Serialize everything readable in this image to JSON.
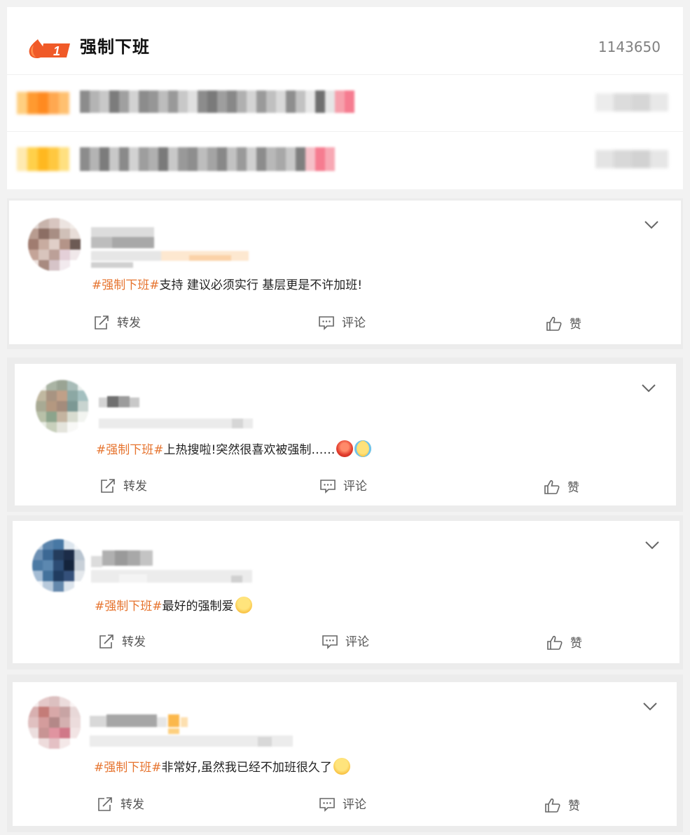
{
  "topic": {
    "rank": "1",
    "title": "强制下班",
    "count": "1143650"
  },
  "posts": [
    {
      "topic_tag": "#强制下班#",
      "text": "支持 建议必须实行 基层更是不许加班!",
      "actions": {
        "repost": "转发",
        "comment": "评论",
        "like": "赞"
      }
    },
    {
      "topic_tag": "#强制下班#",
      "text": "上热搜啦!突然很喜欢被强制……",
      "emojis": [
        "pouting-face-emoji",
        "tears-of-joy-emoji"
      ],
      "actions": {
        "repost": "转发",
        "comment": "评论",
        "like": "赞"
      }
    },
    {
      "topic_tag": "#强制下班#",
      "text": "最好的强制爱",
      "emojis": [
        "smirk-face-emoji"
      ],
      "actions": {
        "repost": "转发",
        "comment": "评论",
        "like": "赞"
      }
    },
    {
      "topic_tag": "#强制下班#",
      "text": "非常好,虽然我已经不加班很久了",
      "emojis": [
        "shushing-face-emoji"
      ],
      "actions": {
        "repost": "转发",
        "comment": "评论",
        "like": "赞"
      }
    }
  ],
  "colors": {
    "topic_tag": "#e6742f",
    "rank_badge": "#f05a28",
    "background": "#f2f2f2"
  }
}
